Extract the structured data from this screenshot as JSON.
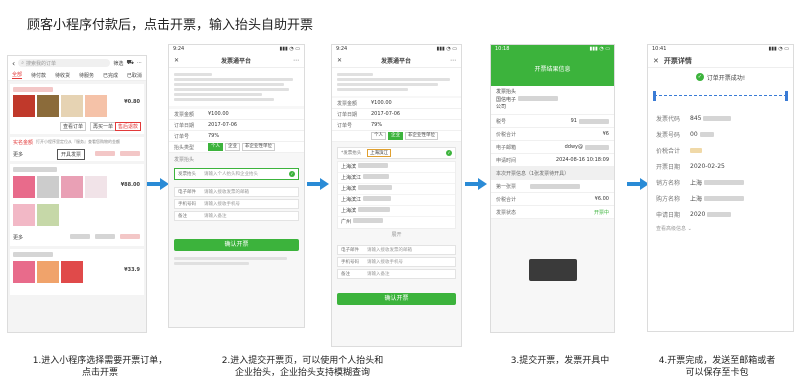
{
  "headline": "顾客小程序付款后，点击开票，输入抬头自助开票",
  "captions": {
    "step1": [
      "1.进入小程序选择需要开票订单，",
      "点击开票"
    ],
    "step2": [
      "2.进入提交开票页，可以使用个人抬头和",
      "企业抬头，企业抬头支持模糊查询"
    ],
    "step3": [
      "3.提交开票，发票开具中"
    ],
    "step4": [
      "4.开票完成，发送至邮箱或者",
      "可以保存至卡包"
    ]
  },
  "colors": {
    "accent_green": "#3cb33c",
    "arrow_blue": "#2a8bd6",
    "order_red": "#e23a3a"
  },
  "phone1": {
    "search_placeholder": "搜索我的订单",
    "filter_label": "筛选",
    "tabs": [
      "全部",
      "待付款",
      "待收货",
      "待服务",
      "已完成",
      "已取消"
    ],
    "order_buttons": [
      "查看订单",
      "再买一单",
      "售后退款"
    ],
    "more_label": "更多",
    "invoice_button": "开具发票",
    "notice_label": "实名金额",
    "notice_text": "打开小程序里定位从『服务』查看您购物的金额",
    "prices": [
      "¥0.80",
      "¥88.00",
      "¥33.9"
    ]
  },
  "phone2": {
    "time": "9:24",
    "title": "发票通平台",
    "fields": [
      {
        "label": "发票金额",
        "value": "¥100.00"
      },
      {
        "label": "订单日期",
        "value": "2017-07-06"
      },
      {
        "label": "订单号",
        "value": "79%"
      }
    ],
    "type_label": "抬头类型",
    "type_options": [
      "个人",
      "企业",
      "非企业性单位"
    ],
    "title_section": "发票抬头",
    "title_placeholder": "请输入个人抬头和企业抬头",
    "inputs": [
      {
        "label": "电子邮件",
        "placeholder": "请输入接收发票的邮箱"
      },
      {
        "label": "手机号码",
        "placeholder": "请输入接收手机号"
      },
      {
        "label": "备注",
        "placeholder": "请输入备注"
      }
    ],
    "submit": "确认开票"
  },
  "phone3": {
    "time": "9:24",
    "title": "发票通平台",
    "fields": [
      {
        "label": "发票金额",
        "value": "¥100.00"
      },
      {
        "label": "订单日期",
        "value": "2017-07-06"
      },
      {
        "label": "订单号",
        "value": "79%"
      }
    ],
    "type_options": [
      "个人",
      "企业",
      "非企业性单位"
    ],
    "query_text": "上海滨江",
    "suggestions": [
      "上海滨",
      "上海滨江",
      "上海滨",
      "上海滨江",
      "上海滨",
      "广州"
    ],
    "more_label": "展开",
    "inputs": [
      {
        "label": "电子邮件",
        "placeholder": "请输入接收发票的邮箱"
      },
      {
        "label": "手机号码",
        "placeholder": "请输入接收手机号"
      },
      {
        "label": "备注",
        "placeholder": "请输入备注"
      }
    ],
    "submit": "确认开票"
  },
  "phone4": {
    "time": "10:18",
    "banner": "开票结果信息",
    "company_label": "发票抬头",
    "company_value": "国信电子",
    "company_suffix": "公司",
    "rows": [
      {
        "label": "税号",
        "value": "91"
      },
      {
        "label": "价税合计",
        "value": "¥6"
      },
      {
        "label": "电子邮箱",
        "value": "ddwy@"
      },
      {
        "label": "申请时间",
        "value": "2024-08-16 10:18:09"
      }
    ],
    "section": "本次开票信息（1张发票待开具）",
    "item_label": "第一张票",
    "item_total_label": "价税合计",
    "item_total_value": "¥6.00",
    "status_label": "发票状态",
    "status_value": "开票中"
  },
  "phone5": {
    "time": "10:41",
    "title": "开票详情",
    "success": "订单开票成功!",
    "rows": [
      {
        "label": "发票代码",
        "value": "845"
      },
      {
        "label": "发票号码",
        "value": "00"
      },
      {
        "label": "价税合计",
        "value": ""
      },
      {
        "label": "开票日期",
        "value": "2020-02-25"
      },
      {
        "label": "销方名称",
        "value": "上海"
      },
      {
        "label": "购方名称",
        "value": "上海"
      },
      {
        "label": "申请日期",
        "value": "2020"
      }
    ],
    "more_link": "查看高级信息 ⌄"
  }
}
